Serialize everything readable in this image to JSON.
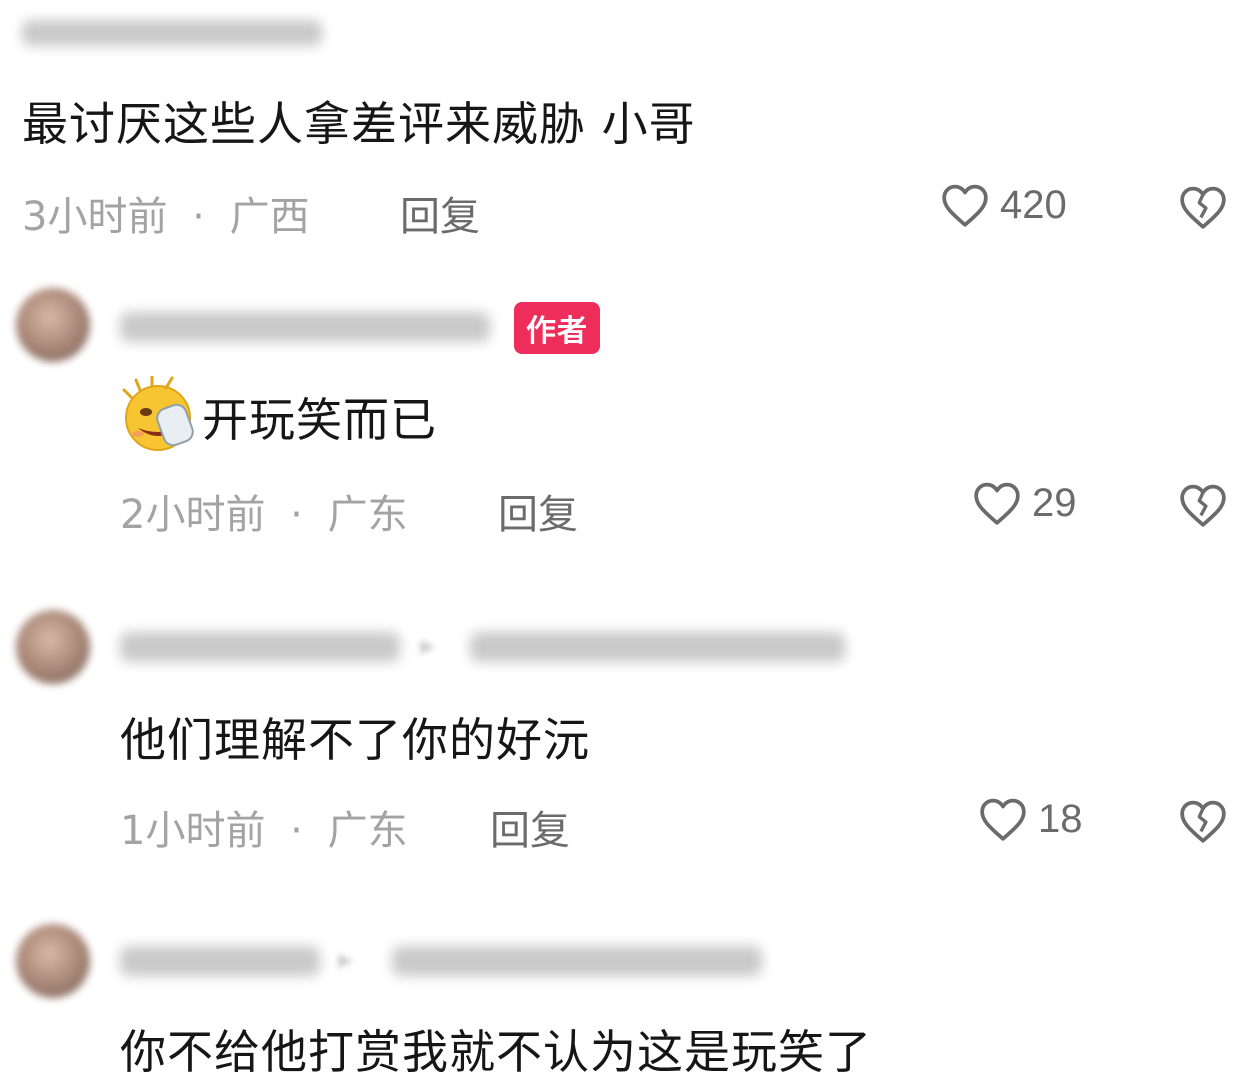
{
  "comments": [
    {
      "text": "最讨厌这些人拿差评来威胁 小哥",
      "time": "3小时前",
      "location": "广西",
      "reply_label": "回复",
      "likes": "420"
    },
    {
      "badge": "作者",
      "emoji_icon": "laughing-emoji-icon",
      "text": "开玩笑而已",
      "time": "2小时前",
      "location": "广东",
      "reply_label": "回复",
      "likes": "29"
    },
    {
      "text": "他们理解不了你的好沅",
      "time": "1小时前",
      "location": "广东",
      "reply_label": "回复",
      "likes": "18"
    },
    {
      "text": "你不给他打赏我就不认为这是玩笑了"
    }
  ],
  "separator": "·",
  "colors": {
    "badge": "#ee2d5b",
    "meta": "#a3a3a3",
    "action": "#6b6b6b"
  }
}
